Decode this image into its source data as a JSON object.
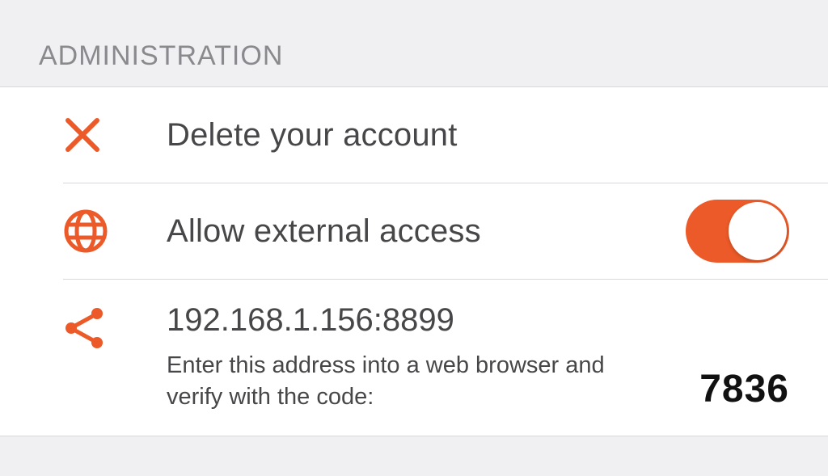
{
  "colors": {
    "accent": "#eb5a28"
  },
  "section": {
    "title": "ADMINISTRATION"
  },
  "rows": {
    "delete": {
      "label": "Delete your account",
      "icon": "x-icon"
    },
    "external": {
      "label": "Allow external access",
      "icon": "globe-icon",
      "toggle_on": true
    },
    "share": {
      "icon": "share-icon",
      "address": "192.168.1.156:8899",
      "instruction": "Enter this address into a web browser and verify with the code:",
      "code": "7836"
    }
  }
}
